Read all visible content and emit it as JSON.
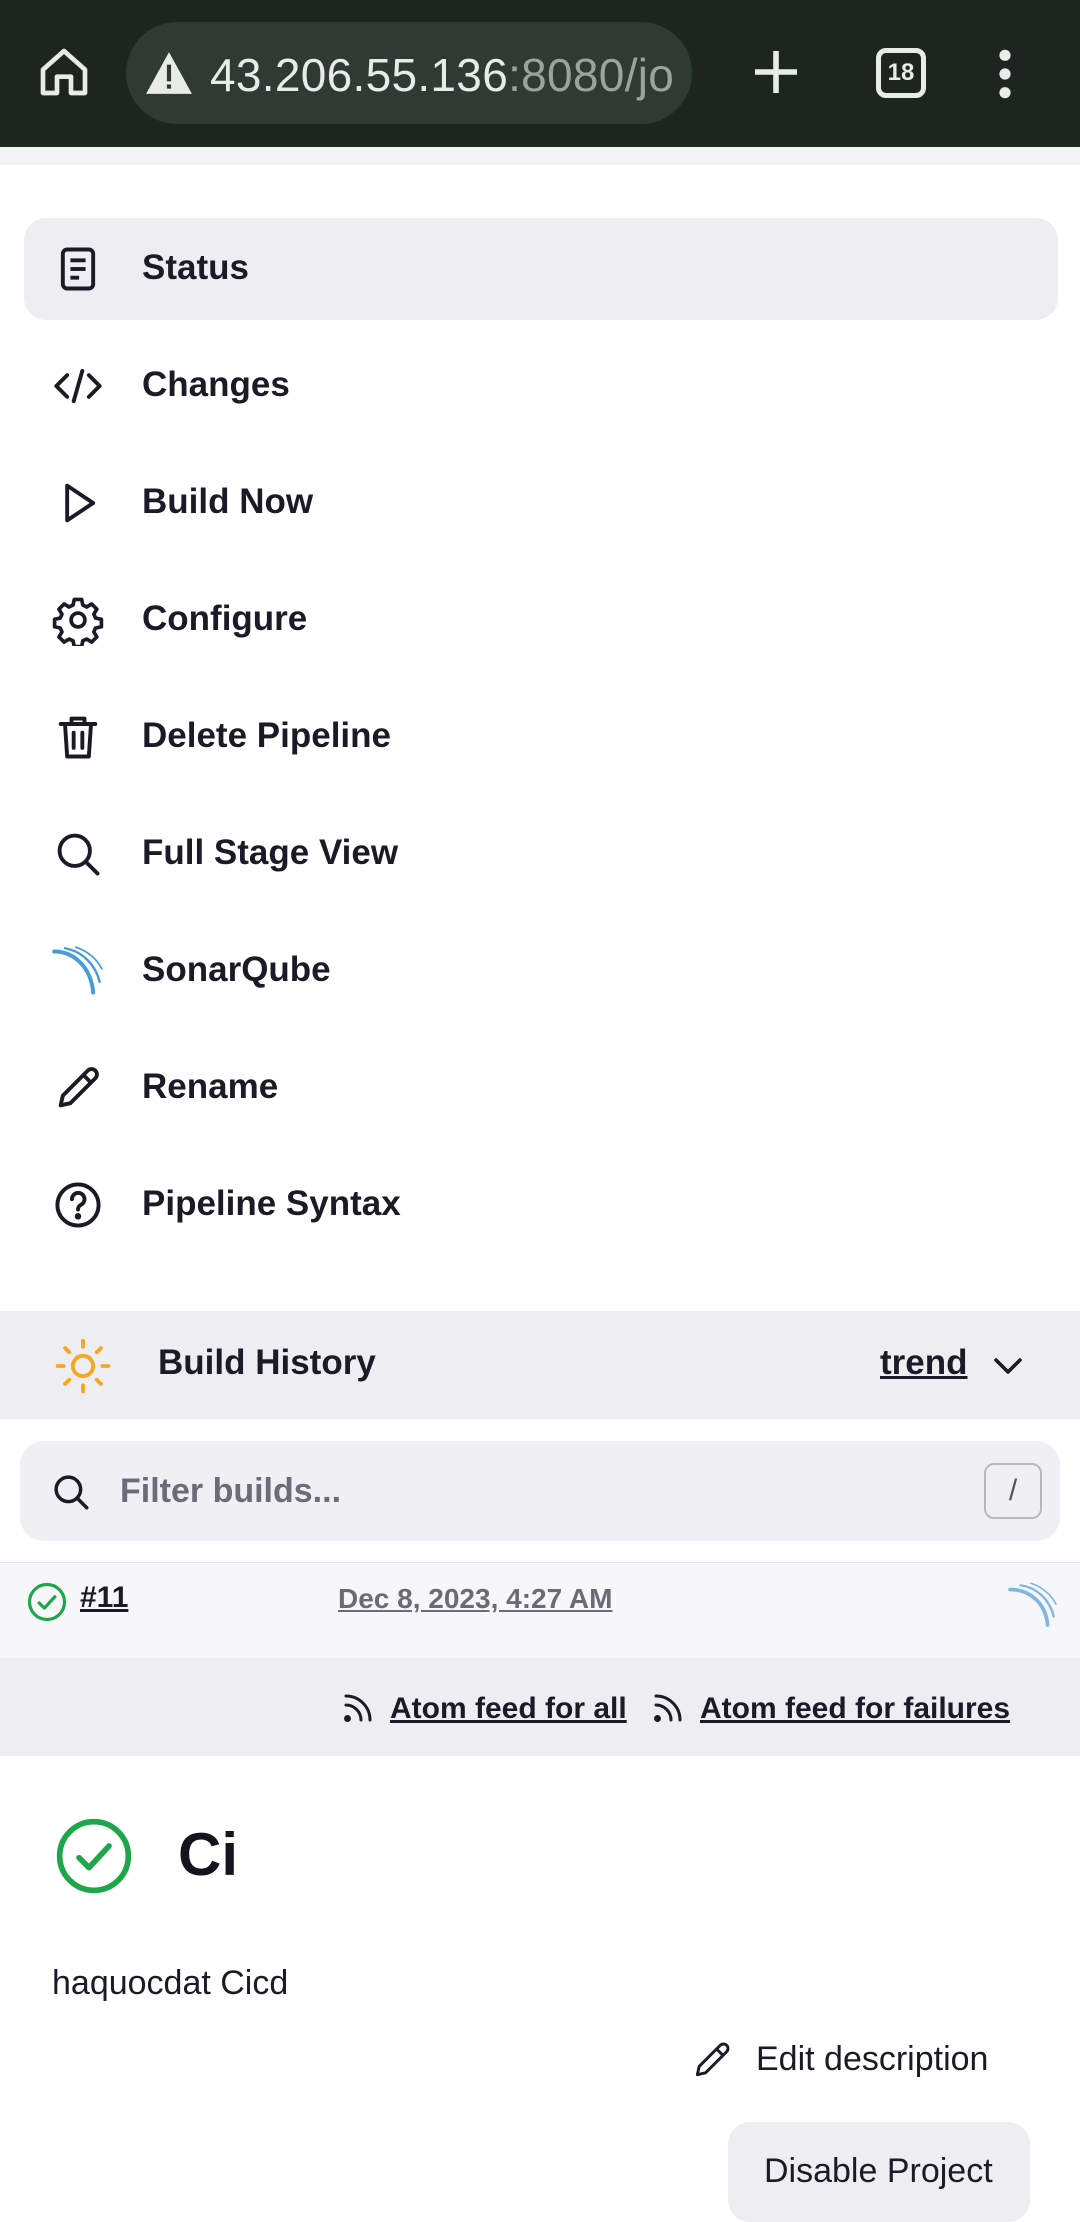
{
  "browser": {
    "url_host": "43.206.55.136",
    "url_rest": ":8080/jo",
    "tab_count": "18"
  },
  "sidebar": {
    "items": [
      {
        "label": "Status",
        "icon": "document-icon",
        "active": true
      },
      {
        "label": "Changes",
        "icon": "code-icon"
      },
      {
        "label": "Build Now",
        "icon": "play-icon"
      },
      {
        "label": "Configure",
        "icon": "gear-icon"
      },
      {
        "label": "Delete Pipeline",
        "icon": "trash-icon"
      },
      {
        "label": "Full Stage View",
        "icon": "search-icon"
      },
      {
        "label": "SonarQube",
        "icon": "sonarqube-icon"
      },
      {
        "label": "Rename",
        "icon": "pencil-icon"
      },
      {
        "label": "Pipeline Syntax",
        "icon": "help-icon"
      }
    ]
  },
  "build_history": {
    "title": "Build History",
    "trend_label": "trend",
    "filter_placeholder": "Filter builds...",
    "shortcut_key": "/",
    "builds": [
      {
        "number": "#11",
        "date": "Dec 8, 2023, 4:27 AM",
        "status": "success"
      }
    ],
    "feed_all": "Atom feed for all",
    "feed_failures": "Atom feed for failures"
  },
  "project": {
    "name": "Ci",
    "description": "haquocdat Cicd",
    "edit_description_label": "Edit description",
    "disable_label": "Disable Project"
  },
  "colors": {
    "success": "#1ea64a",
    "sun": "#f5a623",
    "sonar": "#4a9bd6"
  }
}
